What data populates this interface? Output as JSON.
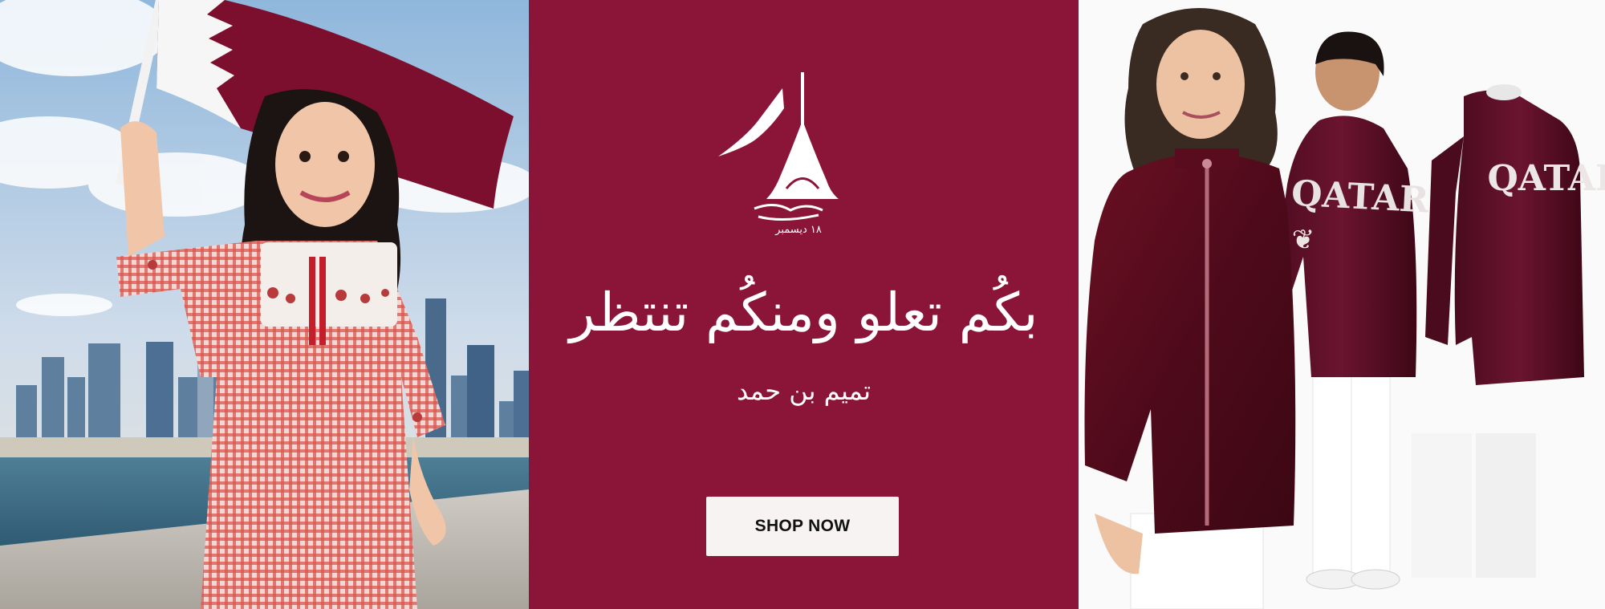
{
  "banner": {
    "center": {
      "headline": "بكُم تعلو ومنكُم تنتظر",
      "signature": "تميم بن حمد",
      "emblem_caption": "١٨ ديسمبر",
      "shop_button_label": "SHOP NOW"
    },
    "right": {
      "jacket_text_1": "QATAR",
      "jacket_text_2": "QATAR"
    }
  },
  "colors": {
    "brand_maroon": "#8b1538",
    "button_bg": "#f7f3f2",
    "button_text": "#111111"
  }
}
